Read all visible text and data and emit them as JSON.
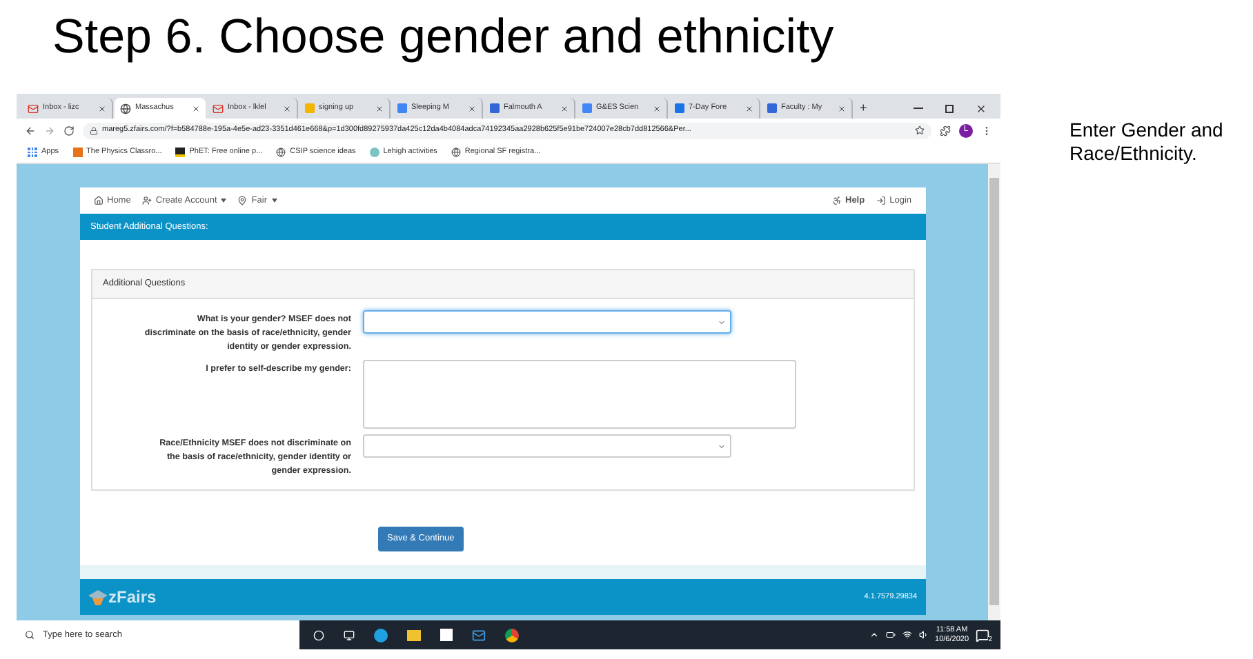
{
  "slide": {
    "title": "Step 6. Choose gender and ethnicity",
    "note": "Enter Gender and Race/Ethnicity."
  },
  "browser": {
    "tabs": [
      {
        "label": "Inbox - lizc",
        "kind": "mail",
        "selected": false
      },
      {
        "label": "Massachus",
        "kind": "globe",
        "selected": true
      },
      {
        "label": "Inbox - lklel",
        "kind": "mail",
        "selected": false
      },
      {
        "label": "signing up",
        "kind": "slides",
        "selected": false
      },
      {
        "label": "Sleeping M",
        "kind": "docs",
        "selected": false
      },
      {
        "label": "Falmouth A",
        "kind": "site",
        "selected": false
      },
      {
        "label": "G&ES Scien",
        "kind": "docs",
        "selected": false
      },
      {
        "label": "7-Day Fore",
        "kind": "weather",
        "selected": false
      },
      {
        "label": "Faculty : My",
        "kind": "site",
        "selected": false
      }
    ],
    "new_tab": "+",
    "url": "mareg5.zfairs.com/?f=b584788e-195a-4e5e-ad23-3351d461e668&p=1d300fd89275937da425c12da4b4084adca74192345aa2928b625f5e91be724007e28cb7dd812566&Per...",
    "profile": "L",
    "bookmarks": [
      {
        "label": "Apps",
        "kind": "apps"
      },
      {
        "label": "The Physics Classro...",
        "kind": "orange"
      },
      {
        "label": "PhET: Free online p...",
        "kind": "dark"
      },
      {
        "label": "CSIP science ideas",
        "kind": "globe"
      },
      {
        "label": "Lehigh activities",
        "kind": "leaf"
      },
      {
        "label": "Regional SF registra...",
        "kind": "globe"
      }
    ]
  },
  "site": {
    "nav_left": [
      {
        "label": "Home",
        "kind": "home",
        "dropdown": false
      },
      {
        "label": "Create Account",
        "kind": "user",
        "dropdown": true
      },
      {
        "label": "Fair",
        "kind": "pin",
        "dropdown": true
      }
    ],
    "nav_right": [
      {
        "label": "Help",
        "kind": "help",
        "bold": true
      },
      {
        "label": "Login",
        "kind": "login",
        "bold": false
      }
    ],
    "page_title": "Student Additional Questions:",
    "panel": {
      "heading": "Additional Questions",
      "questions": [
        {
          "label": "What is your gender? MSEF does not discriminate on the basis of race/ethnicity, gender identity or gender expression.",
          "kind": "select",
          "focused": true
        },
        {
          "label": "I prefer to self-describe my gender:",
          "kind": "textarea",
          "focused": false
        },
        {
          "label": "Race/Ethnicity MSEF does not discriminate on the basis of race/ethnicity, gender identity or gender expression.",
          "kind": "select",
          "focused": false
        }
      ]
    },
    "submit": "Save & Continue",
    "footer": {
      "logo": "zFairs",
      "version": "4.1.7579.29834"
    }
  },
  "taskbar": {
    "search_placeholder": "Type here to search",
    "time": "11:58 AM",
    "date": "10/6/2020",
    "notifications": "2"
  }
}
